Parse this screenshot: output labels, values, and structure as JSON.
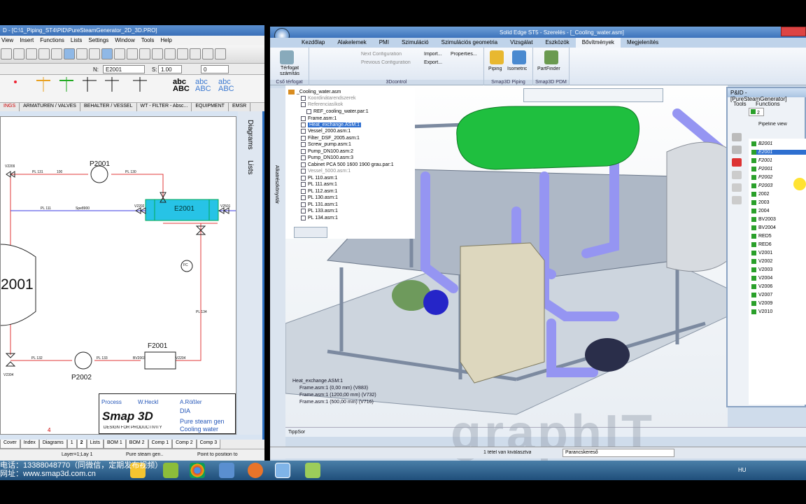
{
  "left_window": {
    "title": "D - [C:\\1_Piping_ST4\\PID\\PureSteamGenerator_2D_3D.PRO]",
    "menu": [
      "View",
      "Insert",
      "Functions",
      "Lists",
      "Settings",
      "Window",
      "Tools",
      "Help"
    ],
    "n_label": "N:",
    "n_value": "E2001",
    "s_label": "S:",
    "s_value": "1.00",
    "rot_value": "0",
    "abc_label": "abc",
    "categories": [
      "INGS",
      "ARMATUREN / VALVES",
      "BEHALTER / VESSEL",
      "WT - FILTER - Absc...",
      "EQUIPMENT",
      "EMSR"
    ],
    "side_tabs": [
      "Diagrams",
      "Lists"
    ],
    "sheet_tabs": [
      "Cover",
      "Index",
      "Diagrams",
      "1",
      "2",
      "Lists",
      "BOM 1",
      "BOM 2",
      "Comp 1",
      "Comp 2",
      "Comp 3"
    ],
    "status": [
      "Layer=1;Lay 1",
      "Pure steam gen..",
      "Point to position to"
    ],
    "page_number": "4",
    "diagram": {
      "tags": [
        "P2001",
        "E2001",
        "2001",
        "F2001",
        "P2002",
        "V2209",
        "V2202",
        "V2501",
        "V2302",
        "V2304",
        "V2210",
        "BV2003",
        "V2204",
        "FC"
      ],
      "pipes": [
        "PL 131",
        "PL 130",
        "PL 111",
        "PL 132",
        "PL 133",
        "PL 134",
        "PL 112"
      ],
      "pipe_size": "100",
      "spec": "Spe8900"
    },
    "title_block": {
      "responsible": "Process",
      "reviewer": "W.Heckl",
      "creator": "A.Rößler",
      "doc_type": "DIA",
      "doc_title": "Pure steam gen",
      "doc_title2": "Cooling water",
      "logo": "Smap 3D",
      "logo_sub": "DESIGN FOR PRODUCTIVITY"
    }
  },
  "se_window": {
    "title": "Solid Edge ST5 - Szerelés - [_Cooling_water.asm]",
    "tabs": [
      "Kezdőlap",
      "Alakelemek",
      "PMI",
      "Szimuláció",
      "Szimulációs geometria",
      "Vizsgálat",
      "Eszközök",
      "Bővítmények",
      "Megjelenítés"
    ],
    "active_tab": "Bővítmények",
    "ribbon": {
      "g1_btn": "Térfogat számítás",
      "g1_label": "Cső térfogat",
      "g2_items": [
        "Next Configuration",
        "Previous Configuration",
        "Import...",
        "Export...",
        "Properties..."
      ],
      "g2_label": "3Dcontrol",
      "g3_btns": [
        "Piping",
        "Isometric"
      ],
      "g3_label": "Smap3D Piping",
      "g4_btn": "PartFinder",
      "g4_label": "Smap3D PDM"
    },
    "tree": [
      "_Cooling_water.asm",
      "Koordinátarendszerek",
      "Referenciasíkok",
      "REF_cooling_water.par:1",
      "Frame.asm:1",
      "Heat_exchange.ASM:1",
      "Vessel_2000.asm:1",
      "Filter_DSF_2005.asm:1",
      "Screw_pump.asm:1",
      "Pump_DN100.asm:2",
      "Pump_DN100.asm:3",
      "Cabinet PCA 500 1600 1900 grau.par:1",
      "Vessel_5000.asm:1",
      "PL 110.asm:1",
      "PL 111.asm:1",
      "PL 112.asm:1",
      "PL 130.asm:1",
      "PL 131.asm:1",
      "PL 133.asm:1",
      "PL 134.asm:1"
    ],
    "side_tab": "Alkatrészkönyvtár",
    "bom_overlay": [
      "Heat_exchange.ASM:1",
      "Frame.asm:1",
      "(0,00 mm)",
      "(V883)",
      "Frame.asm:1",
      "(1200,00 mm)",
      "(V732)",
      "Frame.asm:1",
      "(500,00 mm)",
      "(V716)"
    ],
    "tippsor": "TippSor",
    "status_sel": "1 tétel van kiválasztva",
    "status_cmd": "Parancskereső",
    "watermark": "graphIT"
  },
  "pid_panel": {
    "title": "P&ID - [PureSteamGenerator]",
    "menu": [
      "Tools",
      "Functions"
    ],
    "count": "2",
    "pipeline_view": "Pipeline view",
    "items": [
      "B2001",
      "E2001",
      "F2001",
      "P2001",
      "P2002",
      "P2003",
      "2002",
      "2003",
      "2004",
      "BV2003",
      "BV2004",
      "RED5",
      "RED6",
      "V2001",
      "V2002",
      "V2003",
      "V2004",
      "V2006",
      "V2007",
      "V2009",
      "V2010"
    ],
    "selected": "E2001"
  },
  "taskbar": {
    "lang": "HU",
    "overlay_line1": "电话：13388048770（同微信，定期发布视频）",
    "overlay_line2": "网址：www.smap3d.com.cn"
  },
  "colors": {
    "pipe_red": "#e23a3a",
    "pipe_blue": "#3a3ae2",
    "exchanger": "#1fbf3f",
    "heat_cyan": "#27c3e6",
    "frame": "#9aa6b6",
    "pipe_purple": "#7a7af0"
  }
}
